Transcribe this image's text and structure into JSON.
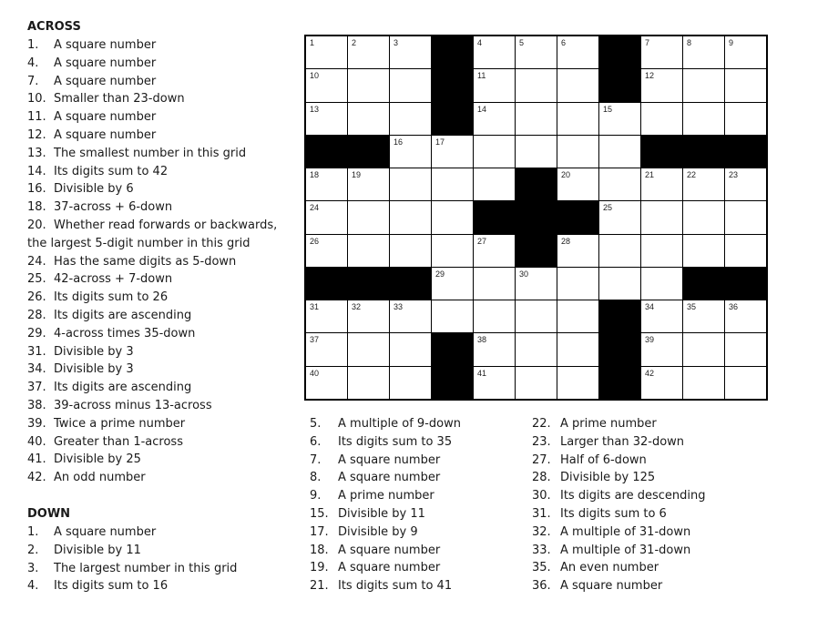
{
  "across": {
    "heading": "ACROSS",
    "clues": [
      {
        "num": "1.",
        "text": "A square number"
      },
      {
        "num": "4.",
        "text": "A square number"
      },
      {
        "num": "7.",
        "text": "A square number"
      },
      {
        "num": "10.",
        "text": "Smaller than 23-down"
      },
      {
        "num": "11.",
        "text": "A square number"
      },
      {
        "num": "12.",
        "text": "A square number"
      },
      {
        "num": "13.",
        "text": "The smallest number in this grid"
      },
      {
        "num": "14.",
        "text": "Its digits sum to 42"
      },
      {
        "num": "16.",
        "text": "Divisible by 6"
      },
      {
        "num": "18.",
        "text": "37-across + 6-down"
      },
      {
        "num": "20.",
        "text": "Whether read forwards or backwards,",
        "continuation": "the largest 5-digit number in this grid"
      },
      {
        "num": "24.",
        "text": "Has the same digits as 5-down"
      },
      {
        "num": "25.",
        "text": "42-across + 7-down"
      },
      {
        "num": "26.",
        "text": "Its digits sum to 26"
      },
      {
        "num": "28.",
        "text": "Its digits are ascending"
      },
      {
        "num": "29.",
        "text": "4-across times 35-down"
      },
      {
        "num": "31.",
        "text": "Divisible by 3"
      },
      {
        "num": "34.",
        "text": "Divisible by 3"
      },
      {
        "num": "37.",
        "text": "Its digits are ascending"
      },
      {
        "num": "38.",
        "text": "39-across minus 13-across"
      },
      {
        "num": "39.",
        "text": "Twice a prime number"
      },
      {
        "num": "40.",
        "text": "Greater than 1-across"
      },
      {
        "num": "41.",
        "text": "Divisible by 25"
      },
      {
        "num": "42.",
        "text": "An odd number"
      }
    ]
  },
  "down": {
    "heading": "DOWN",
    "clues": [
      {
        "num": "1.",
        "text": "A square number"
      },
      {
        "num": "2.",
        "text": "Divisible by 11"
      },
      {
        "num": "3.",
        "text": "The largest number in this grid"
      },
      {
        "num": "4.",
        "text": "Its digits sum to 16"
      },
      {
        "num": "5.",
        "text": "A multiple of 9-down"
      },
      {
        "num": "6.",
        "text": "Its digits sum to 35"
      },
      {
        "num": "7.",
        "text": "A square number"
      },
      {
        "num": "8.",
        "text": "A square number"
      },
      {
        "num": "9.",
        "text": "A prime number"
      },
      {
        "num": "15.",
        "text": "Divisible by 11"
      },
      {
        "num": "17.",
        "text": "Divisible by 9"
      },
      {
        "num": "18.",
        "text": "A square number"
      },
      {
        "num": "19.",
        "text": "A square number"
      },
      {
        "num": "21.",
        "text": "Its digits sum to 41"
      },
      {
        "num": "22.",
        "text": "A prime number"
      },
      {
        "num": "23.",
        "text": "Larger than 32-down"
      },
      {
        "num": "27.",
        "text": "Half of 6-down"
      },
      {
        "num": "28.",
        "text": "Divisible by 125"
      },
      {
        "num": "30.",
        "text": "Its digits are descending"
      },
      {
        "num": "31.",
        "text": "Its digits sum to 6"
      },
      {
        "num": "32.",
        "text": "A multiple of 31-down"
      },
      {
        "num": "33.",
        "text": "A multiple of 31-down"
      },
      {
        "num": "35.",
        "text": "An even number"
      },
      {
        "num": "36.",
        "text": "A square number"
      }
    ]
  },
  "grid": {
    "size": 11,
    "rows": [
      [
        "1",
        "2",
        "3",
        "#",
        "4",
        "5",
        "6",
        "#",
        "7",
        "8",
        "9"
      ],
      [
        "10",
        "",
        "",
        "#",
        "11",
        "",
        "",
        "#",
        "12",
        "",
        ""
      ],
      [
        "13",
        "",
        "",
        "#",
        "14",
        "",
        "",
        "15",
        "",
        "",
        ""
      ],
      [
        "#",
        "#",
        "16",
        "17",
        "",
        "",
        "",
        "",
        "#",
        "#",
        "#"
      ],
      [
        "18",
        "19",
        "",
        "",
        "",
        "#",
        "20",
        "",
        "21",
        "22",
        "23"
      ],
      [
        "24",
        "",
        "",
        "",
        "#",
        "#",
        "#",
        "25",
        "",
        "",
        ""
      ],
      [
        "26",
        "",
        "",
        "",
        "27",
        "#",
        "28",
        "",
        "",
        "",
        ""
      ],
      [
        "#",
        "#",
        "#",
        "29",
        "",
        "30",
        "",
        "",
        "",
        "#",
        "#"
      ],
      [
        "31",
        "32",
        "33",
        "",
        "",
        "",
        "",
        "#",
        "34",
        "35",
        "36"
      ],
      [
        "37",
        "",
        "",
        "#",
        "38",
        "",
        "",
        "#",
        "39",
        "",
        ""
      ],
      [
        "40",
        "",
        "",
        "#",
        "41",
        "",
        "",
        "#",
        "42",
        "",
        ""
      ]
    ]
  }
}
